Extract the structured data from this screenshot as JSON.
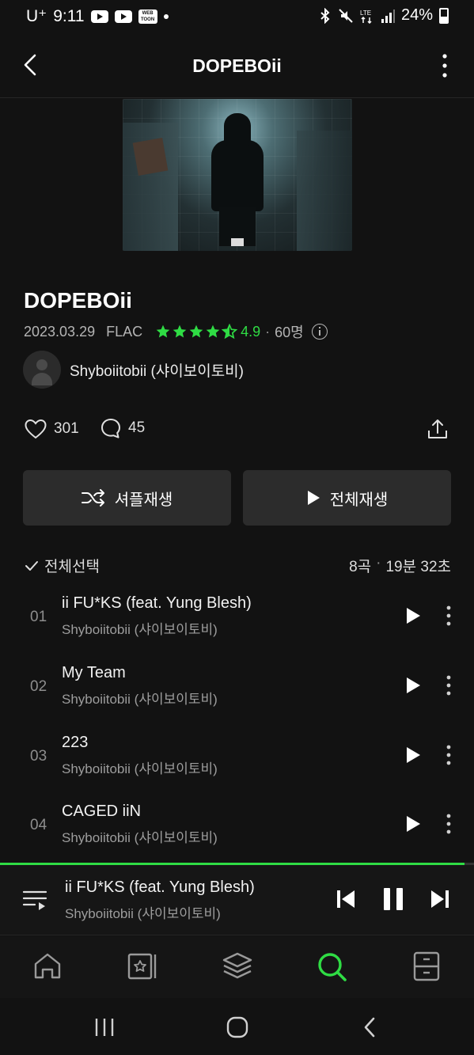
{
  "status_bar": {
    "carrier": "U⁺",
    "time": "9:11",
    "battery": "24%",
    "web_badge": "WEB TOON"
  },
  "header": {
    "title": "DOPEBOii"
  },
  "album": {
    "title": "DOPEBOii",
    "release_date": "2023.03.29",
    "format": "FLAC",
    "rating_stars": 4.5,
    "rating": "4.9",
    "raters": "60명",
    "artist": "Shyboiitobii (샤이보이토비)",
    "likes": "301",
    "comments": "45"
  },
  "actions": {
    "shuffle_label": "셔플재생",
    "play_all_label": "전체재생"
  },
  "track_list": {
    "select_all_label": "전체선택",
    "track_count": "8곡",
    "total_duration": "19분 32초",
    "tracks": [
      {
        "num": "01",
        "title": "ii FU*KS (feat. Yung Blesh)",
        "artist": "Shyboiitobii (샤이보이토비)"
      },
      {
        "num": "02",
        "title": "My Team",
        "artist": "Shyboiitobii (샤이보이토비)"
      },
      {
        "num": "03",
        "title": "223",
        "artist": "Shyboiitobii (샤이보이토비)"
      },
      {
        "num": "04",
        "title": "CAGED iiN",
        "artist": "Shyboiitobii (샤이보이토비)"
      }
    ]
  },
  "now_playing": {
    "title": "ii FU*KS (feat. Yung Blesh)",
    "artist": "Shyboiitobii (샤이보이토비)",
    "progress": 0.98
  },
  "bottom_nav": {
    "items": [
      "home-icon",
      "library-icon",
      "layers-icon",
      "search-icon",
      "storage-icon"
    ],
    "active": "search-icon"
  },
  "colors": {
    "background": "#121212",
    "accent": "#2fdc44",
    "button": "#2c2c2c"
  }
}
